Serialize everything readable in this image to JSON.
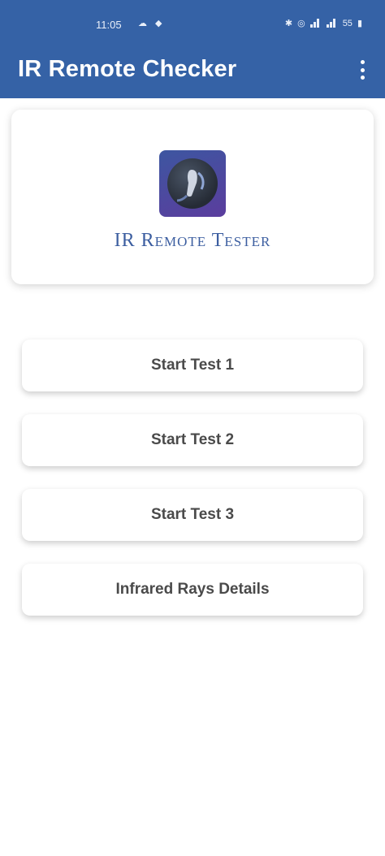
{
  "status_bar": {
    "time": "11:05",
    "left_icons": [
      "cloud-icon",
      "dot-icon"
    ],
    "right_icons": [
      "bluetooth-icon",
      "alarm-icon",
      "signal-icon",
      "signal-icon",
      "battery-icon"
    ],
    "battery_text": "55"
  },
  "app_bar": {
    "title": "IR Remote Checker",
    "menu_icon": "overflow-menu-icon"
  },
  "header_card": {
    "logo_icon": "ir-remote-logo-icon",
    "title": "IR Remote Tester"
  },
  "menu": {
    "items": [
      {
        "label": "Start Test 1"
      },
      {
        "label": "Start Test 2"
      },
      {
        "label": "Start Test 3"
      },
      {
        "label": "Infrared Rays Details"
      }
    ]
  },
  "colors": {
    "app_bar": "#3562a6",
    "title_text": "#3c5ea0",
    "button_text": "#4a4a4a"
  }
}
